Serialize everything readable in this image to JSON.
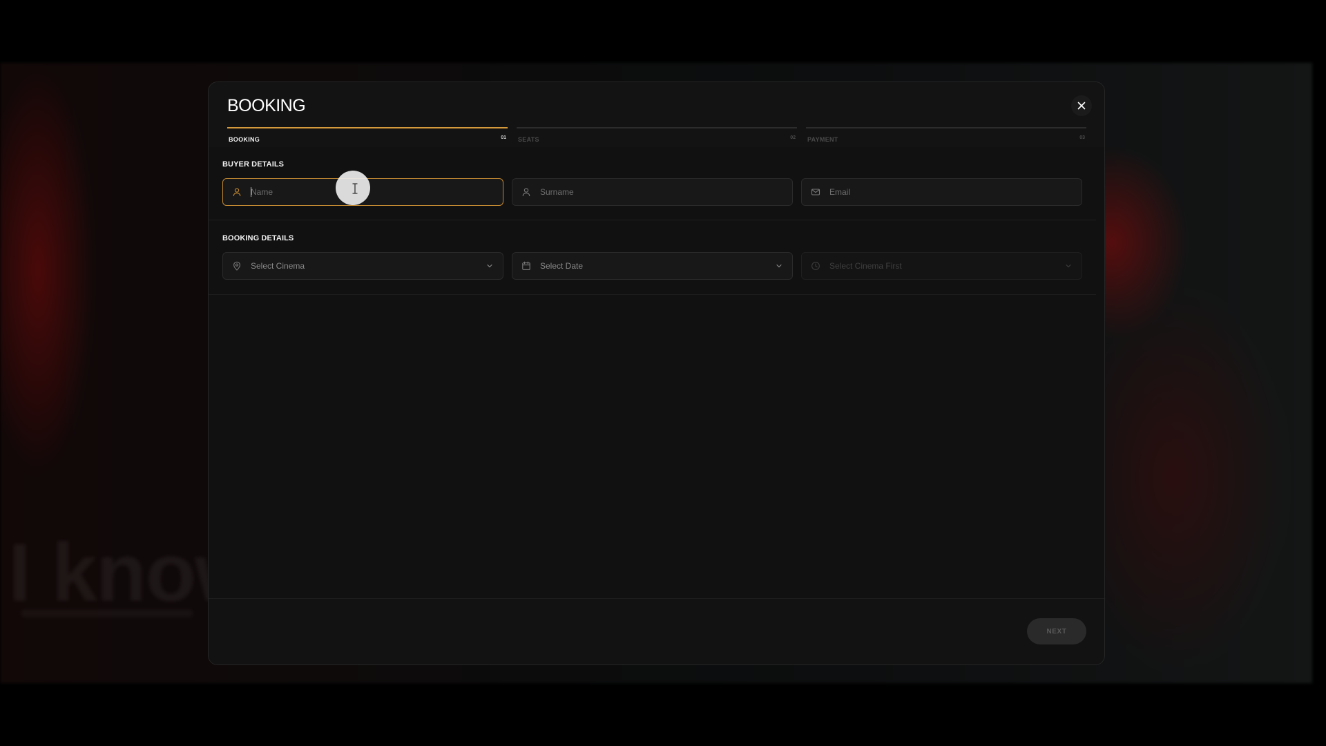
{
  "modal": {
    "title": "BOOKING",
    "close_icon": "close-icon"
  },
  "steps": [
    {
      "label": "BOOKING",
      "number": "01",
      "active": true
    },
    {
      "label": "SEATS",
      "number": "02",
      "active": false
    },
    {
      "label": "PAYMENT",
      "number": "03",
      "active": false
    }
  ],
  "buyer_details": {
    "label": "BUYER DETAILS",
    "name": {
      "placeholder": "Name",
      "value": "",
      "icon": "user-icon"
    },
    "surname": {
      "placeholder": "Surname",
      "value": "",
      "icon": "user-icon"
    },
    "email": {
      "placeholder": "Email",
      "value": "",
      "icon": "mail-icon"
    }
  },
  "booking_details": {
    "label": "BOOKING DETAILS",
    "cinema": {
      "text": "Select Cinema",
      "icon": "map-pin-icon"
    },
    "date": {
      "text": "Select Date",
      "icon": "calendar-icon"
    },
    "time": {
      "text": "Select Cinema First",
      "icon": "clock-icon",
      "disabled": true
    }
  },
  "footer": {
    "next_label": "NEXT"
  },
  "background": {
    "partial_text": "I know"
  },
  "colors": {
    "accent": "#d59a3c",
    "modal_bg": "#111111",
    "field_bg": "#181818"
  }
}
